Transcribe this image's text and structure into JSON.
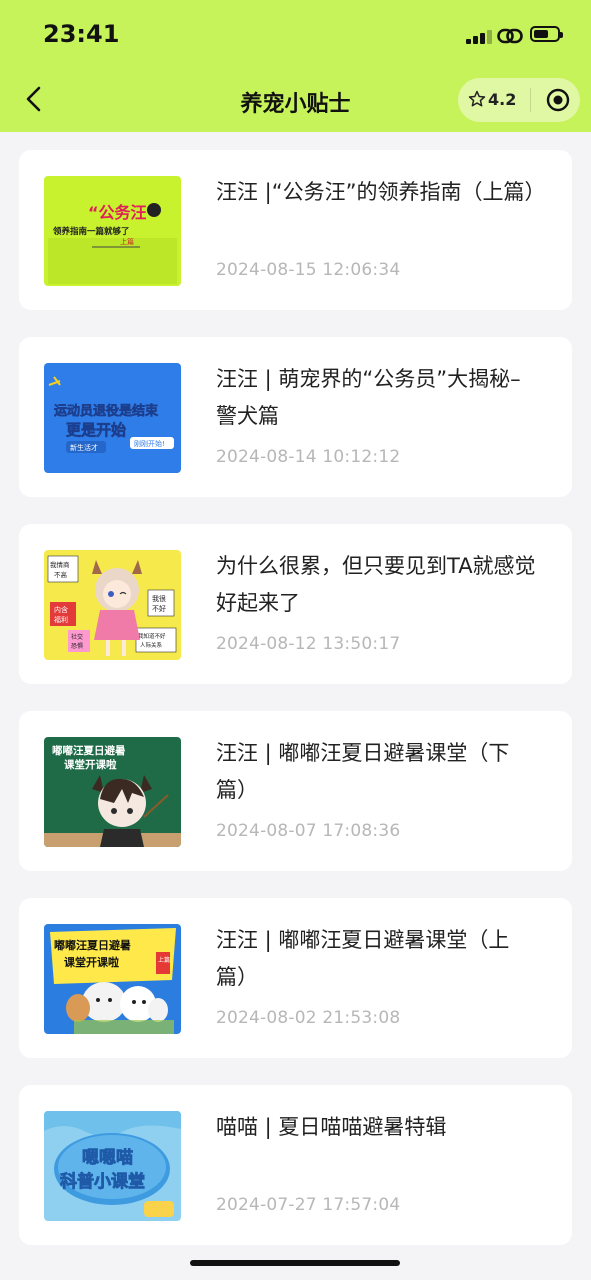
{
  "status": {
    "time": "23:41"
  },
  "nav": {
    "title": "养宠小贴士",
    "rating": "4.2",
    "back_icon": "chevron-left-icon",
    "star_icon": "star-icon",
    "target_icon": "target-icon"
  },
  "colors": {
    "header_bg": "#c6f25a",
    "date_text": "#b7b7b7"
  },
  "articles": [
    {
      "title": "汪汪 |“公务汪”的领养指南（上篇）",
      "date": "2024-08-15 12:06:34",
      "thumb_lines": [
        "“公务汪”",
        "领养指南一篇就够了",
        "上篇"
      ]
    },
    {
      "title": "汪汪 | 萌宠界的“公务员”大揭秘–警犬篇",
      "date": "2024-08-14 10:12:12",
      "thumb_lines": [
        "运动员退役是结束",
        "更是开始",
        "新生活才",
        "刚刚开始!"
      ]
    },
    {
      "title": "为什么很累，但只要见到TA就感觉好起来了",
      "date": "2024-08-12 13:50:17",
      "thumb_lines": [
        "我情商",
        "不高",
        "内含",
        "福利",
        "我很",
        "不好",
        "社交",
        "恐惧",
        "我知道不好",
        "人际关系"
      ]
    },
    {
      "title": "汪汪 | 嘟嘟汪夏日避暑课堂（下篇）",
      "date": "2024-08-07 17:08:36",
      "thumb_lines": [
        "嘟嘟汪夏日避暑",
        "课堂开课啦"
      ]
    },
    {
      "title": "汪汪 | 嘟嘟汪夏日避暑课堂（上篇）",
      "date": "2024-08-02 21:53:08",
      "thumb_lines": [
        "嘟嘟汪夏日避暑",
        "课堂开课啦",
        "上篇"
      ]
    },
    {
      "title": "喵喵 | 夏日喵喵避暑特辑",
      "date": "2024-07-27 17:57:04",
      "thumb_lines": [
        "嗯嗯喵",
        "科普小课堂"
      ]
    }
  ]
}
